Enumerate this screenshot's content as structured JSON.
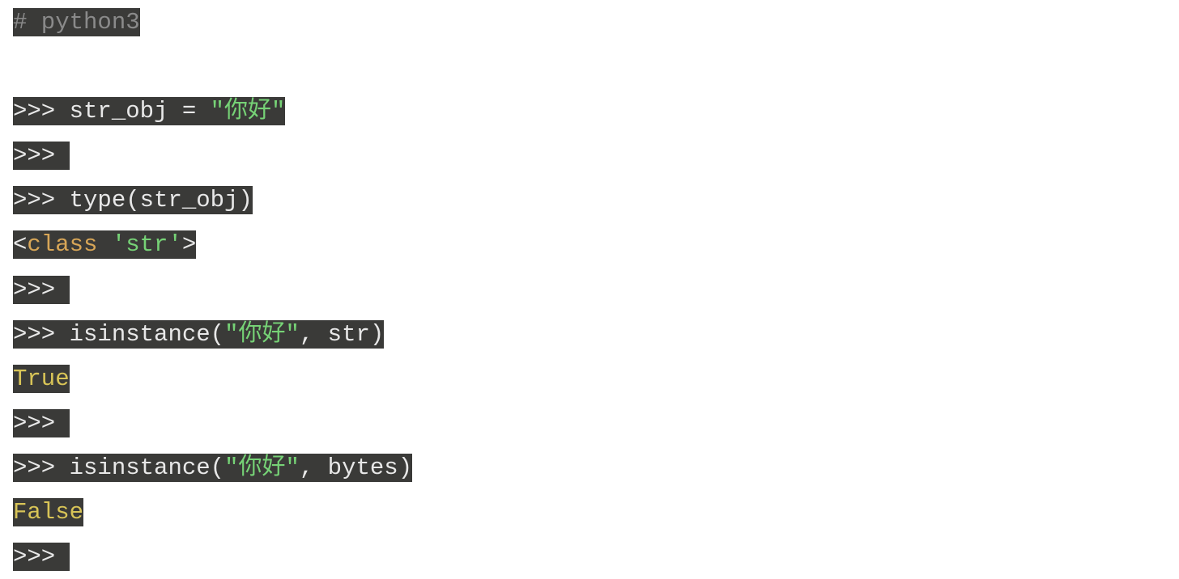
{
  "code": {
    "line1": {
      "comment": "# python3"
    },
    "line3": {
      "prompt": ">>> ",
      "var": "str_obj = ",
      "string": "\"你好\""
    },
    "line4": {
      "prompt": ">>> "
    },
    "line5": {
      "prompt": ">>> ",
      "call": "type(str_obj)"
    },
    "line6": {
      "lt": "<",
      "classkw": "class",
      "space": " ",
      "strlit": "'str'",
      "gt": ">"
    },
    "line7": {
      "prompt": ">>> "
    },
    "line8": {
      "prompt": ">>> ",
      "func": "isinstance(",
      "string": "\"你好\"",
      "rest": ", str)"
    },
    "line9": {
      "val": "True"
    },
    "line10": {
      "prompt": ">>> "
    },
    "line11": {
      "prompt": ">>> ",
      "func": "isinstance(",
      "string": "\"你好\"",
      "rest": ", bytes)"
    },
    "line12": {
      "val": "False"
    },
    "line13": {
      "prompt": ">>> "
    }
  }
}
